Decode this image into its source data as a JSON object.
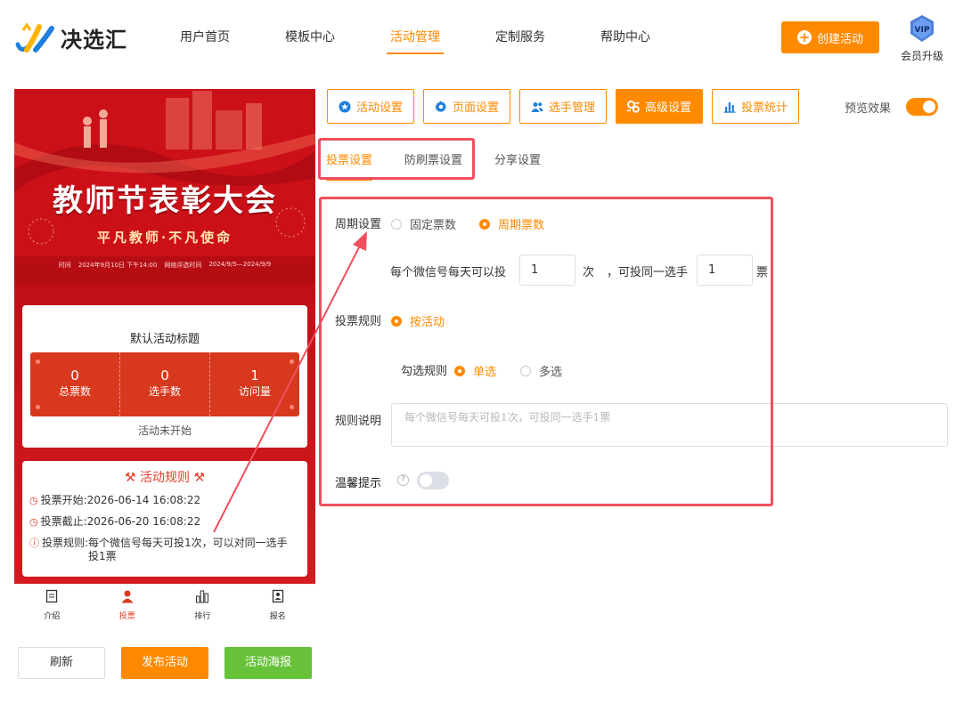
{
  "brand": {
    "name": "决选汇"
  },
  "nav": {
    "items": [
      "用户首页",
      "模板中心",
      "活动管理",
      "定制服务",
      "帮助中心"
    ],
    "active_index": 2
  },
  "header": {
    "create_label": "创建活动",
    "vip_badge": "VIP",
    "vip_label": "会员升级"
  },
  "preview": {
    "banner": {
      "title": "教师节表彰大会",
      "subtitle": "平凡教师·不凡使命",
      "info_left_label": "时间",
      "info_left": "2024年9月10日 下午14:00",
      "info_right_label": "网络评选时间",
      "info_right": "2024/9/5—2024/9/9"
    },
    "card_title": "默认活动标题",
    "stats": [
      {
        "value": "0",
        "label": "总票数"
      },
      {
        "value": "0",
        "label": "选手数"
      },
      {
        "value": "1",
        "label": "访问量"
      }
    ],
    "status": "活动未开始",
    "rules_title": "活动规则",
    "rules": [
      {
        "label": "投票开始:",
        "value": "2026-06-14 16:08:22"
      },
      {
        "label": "投票截止:",
        "value": "2026-06-20 16:08:22"
      },
      {
        "label": "投票规则:",
        "value": "每个微信号每天可投1次，可以对同一选手投1票"
      }
    ],
    "tabbar": [
      {
        "label": "介绍",
        "icon": "document-icon"
      },
      {
        "label": "投票",
        "icon": "person-icon"
      },
      {
        "label": "排行",
        "icon": "bar-chart-icon"
      },
      {
        "label": "报名",
        "icon": "signup-icon"
      }
    ],
    "active_tab_index": 1
  },
  "bottom_buttons": {
    "refresh": "刷新",
    "publish": "发布活动",
    "poster": "活动海报"
  },
  "settings": {
    "tabs": [
      {
        "label": "活动设置",
        "icon": "star-icon"
      },
      {
        "label": "页面设置",
        "icon": "gear-icon"
      },
      {
        "label": "选手管理",
        "icon": "users-icon"
      },
      {
        "label": "高级设置",
        "icon": "advanced-gear-icon"
      },
      {
        "label": "投票统计",
        "icon": "bar-chart-icon"
      }
    ],
    "active_tab_index": 3,
    "preview_label": "预览效果",
    "preview_on": true,
    "subtabs": [
      "投票设置",
      "防刷票设置",
      "分享设置"
    ],
    "active_subtab_index": 0
  },
  "form": {
    "period_label": "周期设置",
    "period_options": [
      "固定票数",
      "周期票数"
    ],
    "period_selected": 1,
    "daily_prefix": "每个微信号每天可以投",
    "daily_value": "1",
    "daily_unit": "次",
    "same_prefix": "，可投同一选手",
    "same_value": "1",
    "same_unit": "票",
    "rule_label": "投票规则",
    "rule_option": "按活动",
    "select_label": "勾选规则",
    "select_options": [
      "单选",
      "多选"
    ],
    "select_selected": 0,
    "desc_label": "规则说明",
    "desc_placeholder": "每个微信号每天可投1次，可投同一选手1票",
    "tips_label": "温馨提示",
    "tips_on": false
  },
  "colors": {
    "accent": "#ff8a00",
    "annotation": "#f0505d",
    "success": "#67c23a",
    "banner_red": "#d3121d"
  }
}
